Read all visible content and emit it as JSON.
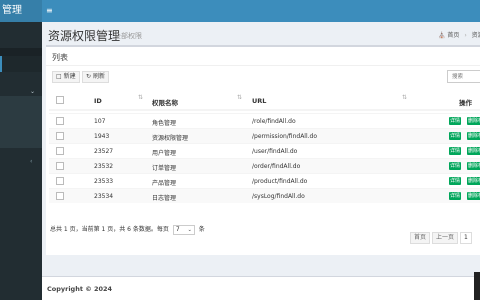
{
  "header": {
    "brand": "管理",
    "menu_icon": "hamburger-icon"
  },
  "content_header": {
    "title": "资源权限管理",
    "subtitle": "全部权限",
    "breadcrumb": [
      "首页",
      "资源"
    ]
  },
  "box": {
    "title": "列表",
    "new_label": "新建",
    "refresh_label": "刷新",
    "search_placeholder": "搜索"
  },
  "table": {
    "headers": {
      "id": "ID",
      "name": "权限名称",
      "url": "URL",
      "ops": "操作"
    },
    "rows": [
      {
        "id": "107",
        "name": "角色管理",
        "url": "/role/findAll.do"
      },
      {
        "id": "1943",
        "name": "资源权限管理",
        "url": "/permission/findAll.do"
      },
      {
        "id": "23527",
        "name": "用户管理",
        "url": "/user/findAll.do"
      },
      {
        "id": "23532",
        "name": "订单管理",
        "url": "/order/findAll.do"
      },
      {
        "id": "23533",
        "name": "产品管理",
        "url": "/product/findAll.do"
      },
      {
        "id": "23534",
        "name": "日志管理",
        "url": "/sysLog/findAll.do"
      }
    ],
    "op_detail": "详情",
    "op_delete": "删除权"
  },
  "pagination": {
    "info_prefix": "总共 1 页，当前第 1 页，共 6 条数据。每页",
    "page_size": "7",
    "info_suffix": "条",
    "first": "首页",
    "prev": "上一页",
    "current": "1"
  },
  "footer": {
    "copyright": "Copyright © 2024"
  }
}
